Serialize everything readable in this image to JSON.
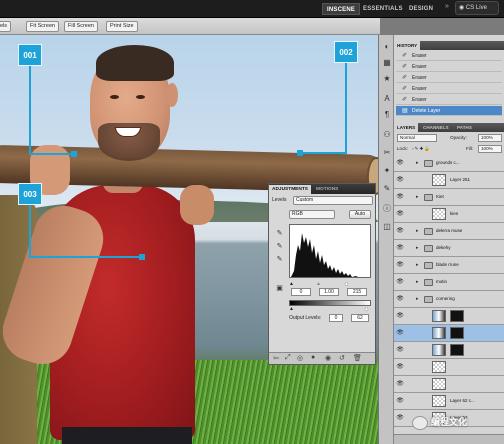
{
  "appbar": {
    "workspaces": [
      "INSCENE",
      "ESSENTIALS",
      "DESIGN"
    ],
    "active_workspace": "INSCENE",
    "cs_live": "CS Live"
  },
  "optbar": {
    "buttons": [
      "els",
      "Fit Screen",
      "Fill Screen",
      "Print Size"
    ]
  },
  "callouts": [
    "001",
    "002",
    "003"
  ],
  "adjustments": {
    "tabs": [
      "ADJUSTMENTS",
      "MOTIONS"
    ],
    "preset_label": "Levels",
    "preset_value": "Custom",
    "channel_value": "RGB",
    "auto_label": "Auto",
    "input_levels": [
      "0",
      "1.00",
      "215"
    ],
    "output_label": "Output Levels:",
    "output_levels": [
      "0",
      "0",
      "62"
    ]
  },
  "history": {
    "title": "HISTORY",
    "items": [
      "Eraser",
      "Eraser",
      "Eraser",
      "Eraser",
      "Eraser",
      "Delete Layer"
    ],
    "selected_index": 5
  },
  "layers": {
    "tabs": [
      "LAYERS",
      "CHANNELS",
      "PATHS"
    ],
    "blend_mode": "Normal",
    "opacity_label": "Opacity:",
    "opacity_value": "100%",
    "lock_label": "Lock:",
    "fill_label": "Fill:",
    "fill_value": "100%",
    "items": [
      {
        "name": "grounds c...",
        "kind": "group"
      },
      {
        "name": "Layer 251",
        "kind": "layer"
      },
      {
        "name": "Kiet",
        "kind": "group"
      },
      {
        "name": "kien",
        "kind": "layer"
      },
      {
        "name": "delerra muse",
        "kind": "group"
      },
      {
        "name": "dekehy",
        "kind": "group"
      },
      {
        "name": "blade rrune",
        "kind": "group"
      },
      {
        "name": "motin",
        "kind": "group"
      },
      {
        "name": "cornering",
        "kind": "group"
      },
      {
        "name": "",
        "kind": "mask"
      },
      {
        "name": "",
        "kind": "mask"
      },
      {
        "name": "",
        "kind": "mask"
      },
      {
        "name": "",
        "kind": "layer"
      },
      {
        "name": "",
        "kind": "layer"
      },
      {
        "name": "Layer 62 c...",
        "kind": "layer"
      },
      {
        "name": "Layer 52",
        "kind": "layer"
      }
    ],
    "selected_index": 10
  },
  "watermark": "编程文化",
  "colors": {
    "accent": "#1ea3d8",
    "selection": "#4c87c7",
    "shirt": "#a11d1f"
  }
}
